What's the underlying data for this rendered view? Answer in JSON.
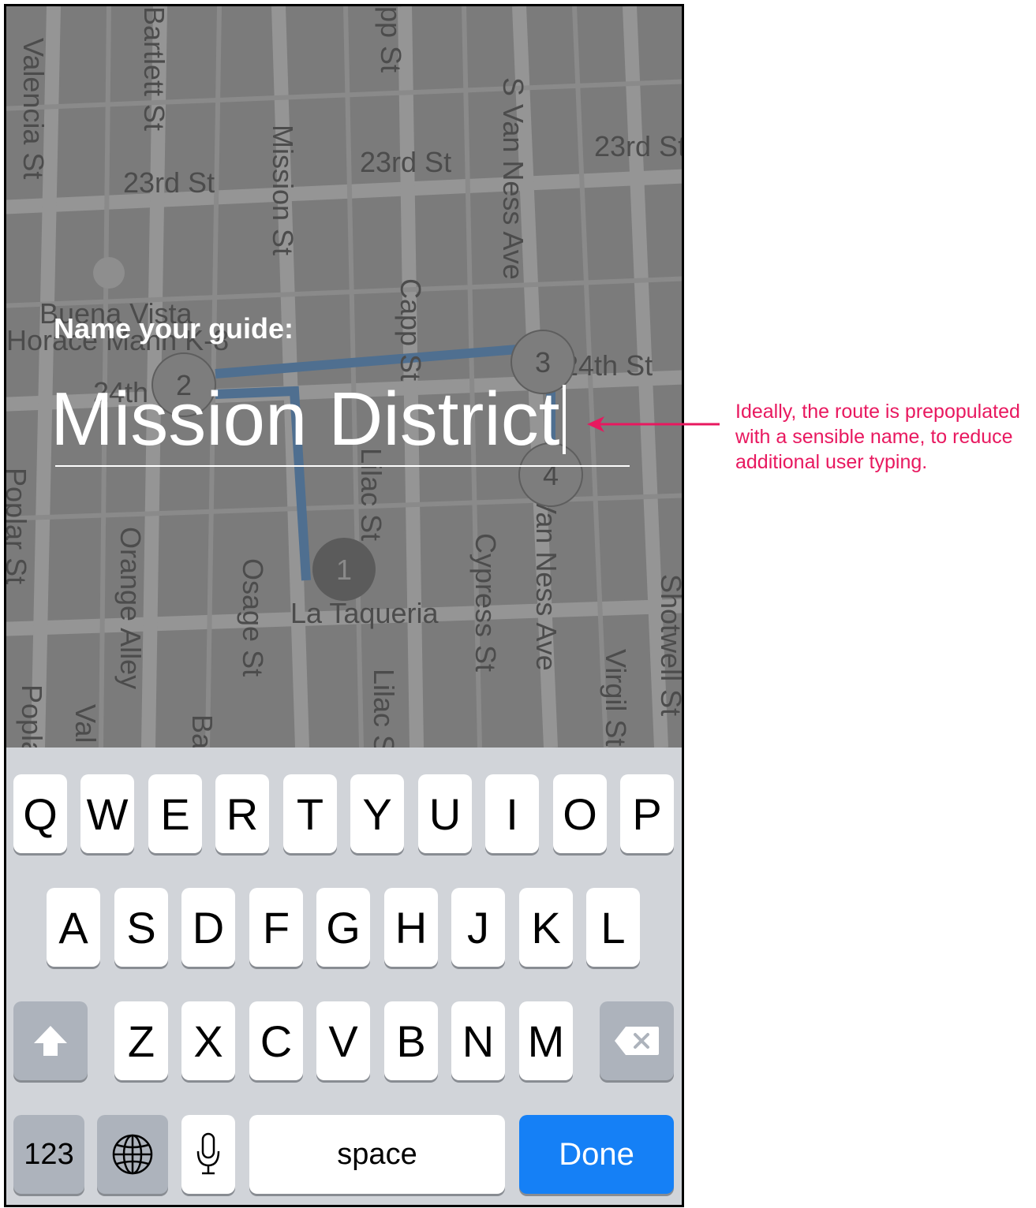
{
  "map": {
    "streets": [
      "Valencia St",
      "Bartlett St",
      "23rd St",
      "Mission St",
      "23rd St",
      "S Van Ness Ave",
      "23rd St",
      "Capp St",
      "Buena Vista",
      "Horace Mann K-8",
      "24th St",
      "24th St",
      "Lilac St",
      "Poplar St",
      "Orange Alley",
      "Osage St",
      "La Taqueria",
      "Cypress St",
      "Van Ness Ave",
      "Shotwell St",
      "Virgil St",
      "Lilac St",
      "Popla",
      "Val",
      "Ba",
      "pp St"
    ],
    "markers": [
      "1",
      "2",
      "3",
      "4"
    ],
    "route_color": "#4f6f90"
  },
  "overlay": {
    "label": "Name your guide:",
    "input_value": "Mission District"
  },
  "keyboard": {
    "row1": [
      "Q",
      "W",
      "E",
      "R",
      "T",
      "Y",
      "U",
      "I",
      "O",
      "P"
    ],
    "row2": [
      "A",
      "S",
      "D",
      "F",
      "G",
      "H",
      "J",
      "K",
      "L"
    ],
    "row3": [
      "Z",
      "X",
      "C",
      "V",
      "B",
      "N",
      "M"
    ],
    "numbers_label": "123",
    "space_label": "space",
    "done_label": "Done",
    "shift_icon": "shift-icon",
    "delete_icon": "delete-icon",
    "globe_icon": "globe-icon",
    "mic_icon": "mic-icon",
    "done_color": "#1580f6"
  },
  "annotation": {
    "text": "Ideally, the route is prepopulated with a sensible name, to reduce additional user typing.",
    "color": "#e8185f"
  }
}
